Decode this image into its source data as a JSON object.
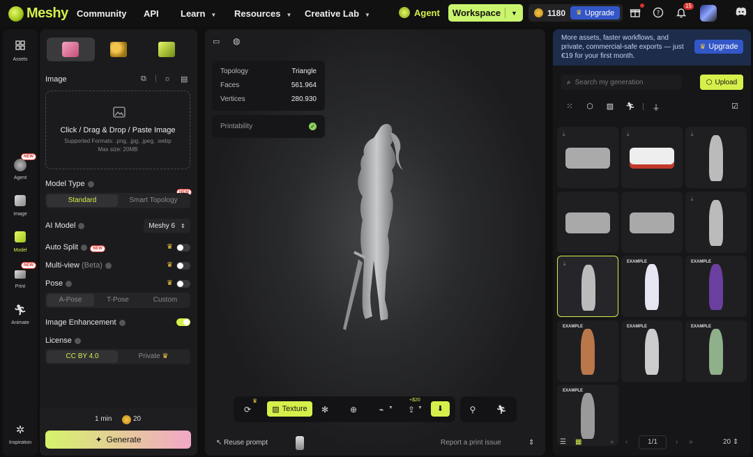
{
  "brand": {
    "name": "Meshy"
  },
  "nav": {
    "community": "Community",
    "api": "API",
    "learn": "Learn",
    "resources": "Resources",
    "creative_lab": "Creative Lab",
    "agent": "Agent",
    "workspace": "Workspace"
  },
  "account": {
    "credits": "1180",
    "upgrade": "Upgrade",
    "notif_count": "15"
  },
  "rail": {
    "assets": "Assets",
    "agent": "Agent",
    "image": "Image",
    "model": "Model",
    "print": "Print",
    "animate": "Animate",
    "inspiration": "Inspiration",
    "new": "NEW"
  },
  "panel": {
    "image_label": "Image",
    "drop_title": "Click / Drag & Drop / Paste Image",
    "drop_formats": "Supported Formats: .png, .jpg, .jpeg, .webp",
    "drop_size": "Max size: 20MB",
    "model_type": "Model Type",
    "standard": "Standard",
    "smart_topology": "Smart Topology",
    "new": "NEW",
    "ai_model": "AI Model",
    "ai_model_value": "Meshy 6",
    "auto_split": "Auto Split",
    "multi_view": "Multi-view",
    "beta": "(Beta)",
    "pose": "Pose",
    "a_pose": "A-Pose",
    "t_pose": "T-Pose",
    "custom": "Custom",
    "image_enhancement": "Image Enhancement",
    "license": "License",
    "cc": "CC BY 4.0",
    "private": "Private",
    "time": "1 min",
    "cost": "20",
    "generate": "Generate"
  },
  "viewer": {
    "topology_label": "Topology",
    "topology_value": "Triangle",
    "faces_label": "Faces",
    "faces_value": "561.964",
    "vertices_label": "Vertices",
    "vertices_value": "280.930",
    "printability": "Printability",
    "texture": "Texture",
    "price": "+$20",
    "reuse": "Reuse prompt",
    "report": "Report a print issue"
  },
  "right": {
    "promo": "More assets, faster workflows, and private, commercial-safe exports — just €19 for your first month.",
    "upgrade": "Upgrade",
    "search_placeholder": "Search my generation",
    "upload": "Upload",
    "example": "EXAMPLE",
    "page": "1/1",
    "per_page": "20"
  }
}
